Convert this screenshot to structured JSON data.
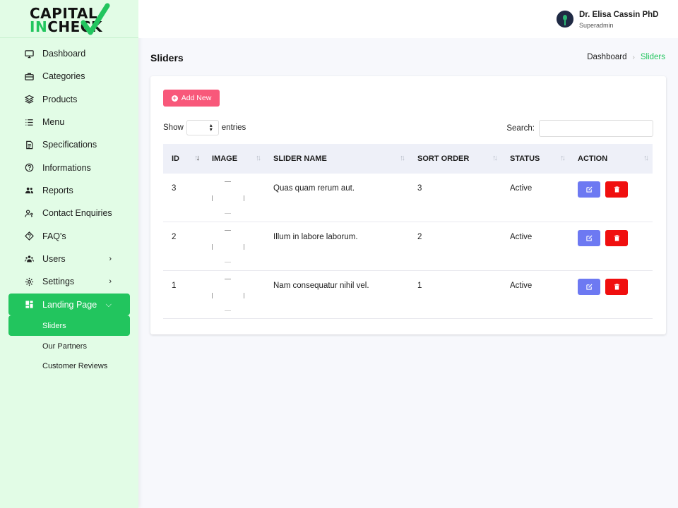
{
  "brand": {
    "line1": "CAPITAL",
    "line2_a": "IN",
    "line2_b": "CHECK"
  },
  "user": {
    "name": "Dr. Elisa Cassin PhD",
    "role": "Superadmin"
  },
  "sidebar": {
    "items": [
      {
        "label": "Dashboard",
        "icon": "monitor-icon"
      },
      {
        "label": "Categories",
        "icon": "briefcase-icon"
      },
      {
        "label": "Products",
        "icon": "layers-icon"
      },
      {
        "label": "Menu",
        "icon": "list-icon"
      },
      {
        "label": "Specifications",
        "icon": "document-icon"
      },
      {
        "label": "Informations",
        "icon": "question-icon"
      },
      {
        "label": "Reports",
        "icon": "people-icon"
      },
      {
        "label": "Contact Enquiries",
        "icon": "user-key-icon"
      },
      {
        "label": "FAQ's",
        "icon": "diamond-question-icon"
      },
      {
        "label": "Users",
        "icon": "users-icon"
      },
      {
        "label": "Settings",
        "icon": "gear-icon"
      },
      {
        "label": "Landing Page",
        "icon": "grid-icon"
      }
    ],
    "sub_items": [
      {
        "label": "Sliders"
      },
      {
        "label": "Our Partners"
      },
      {
        "label": "Customer Reviews"
      }
    ]
  },
  "page": {
    "title": "Sliders"
  },
  "breadcrumb": {
    "home": "Dashboard",
    "current": "Sliders"
  },
  "toolbar": {
    "add_label": "Add New"
  },
  "length": {
    "show": "Show",
    "entries": "entries"
  },
  "search": {
    "label": "Search:",
    "value": ""
  },
  "table": {
    "headers": [
      "ID",
      "IMAGE",
      "SLIDER NAME",
      "SORT ORDER",
      "STATUS",
      "ACTION"
    ],
    "rows": [
      {
        "id": "3",
        "name": "Quas quam rerum aut.",
        "sort": "3",
        "status": "Active"
      },
      {
        "id": "2",
        "name": "Illum in labore laborum.",
        "sort": "2",
        "status": "Active"
      },
      {
        "id": "1",
        "name": "Nam consequatur nihil vel.",
        "sort": "1",
        "status": "Active"
      }
    ]
  },
  "colors": {
    "accent": "#22c55e",
    "add_button": "#f8587a",
    "edit_button": "#6d79f2",
    "delete_button": "#f00f0f",
    "sidebar_bg": "#e2fce6"
  }
}
